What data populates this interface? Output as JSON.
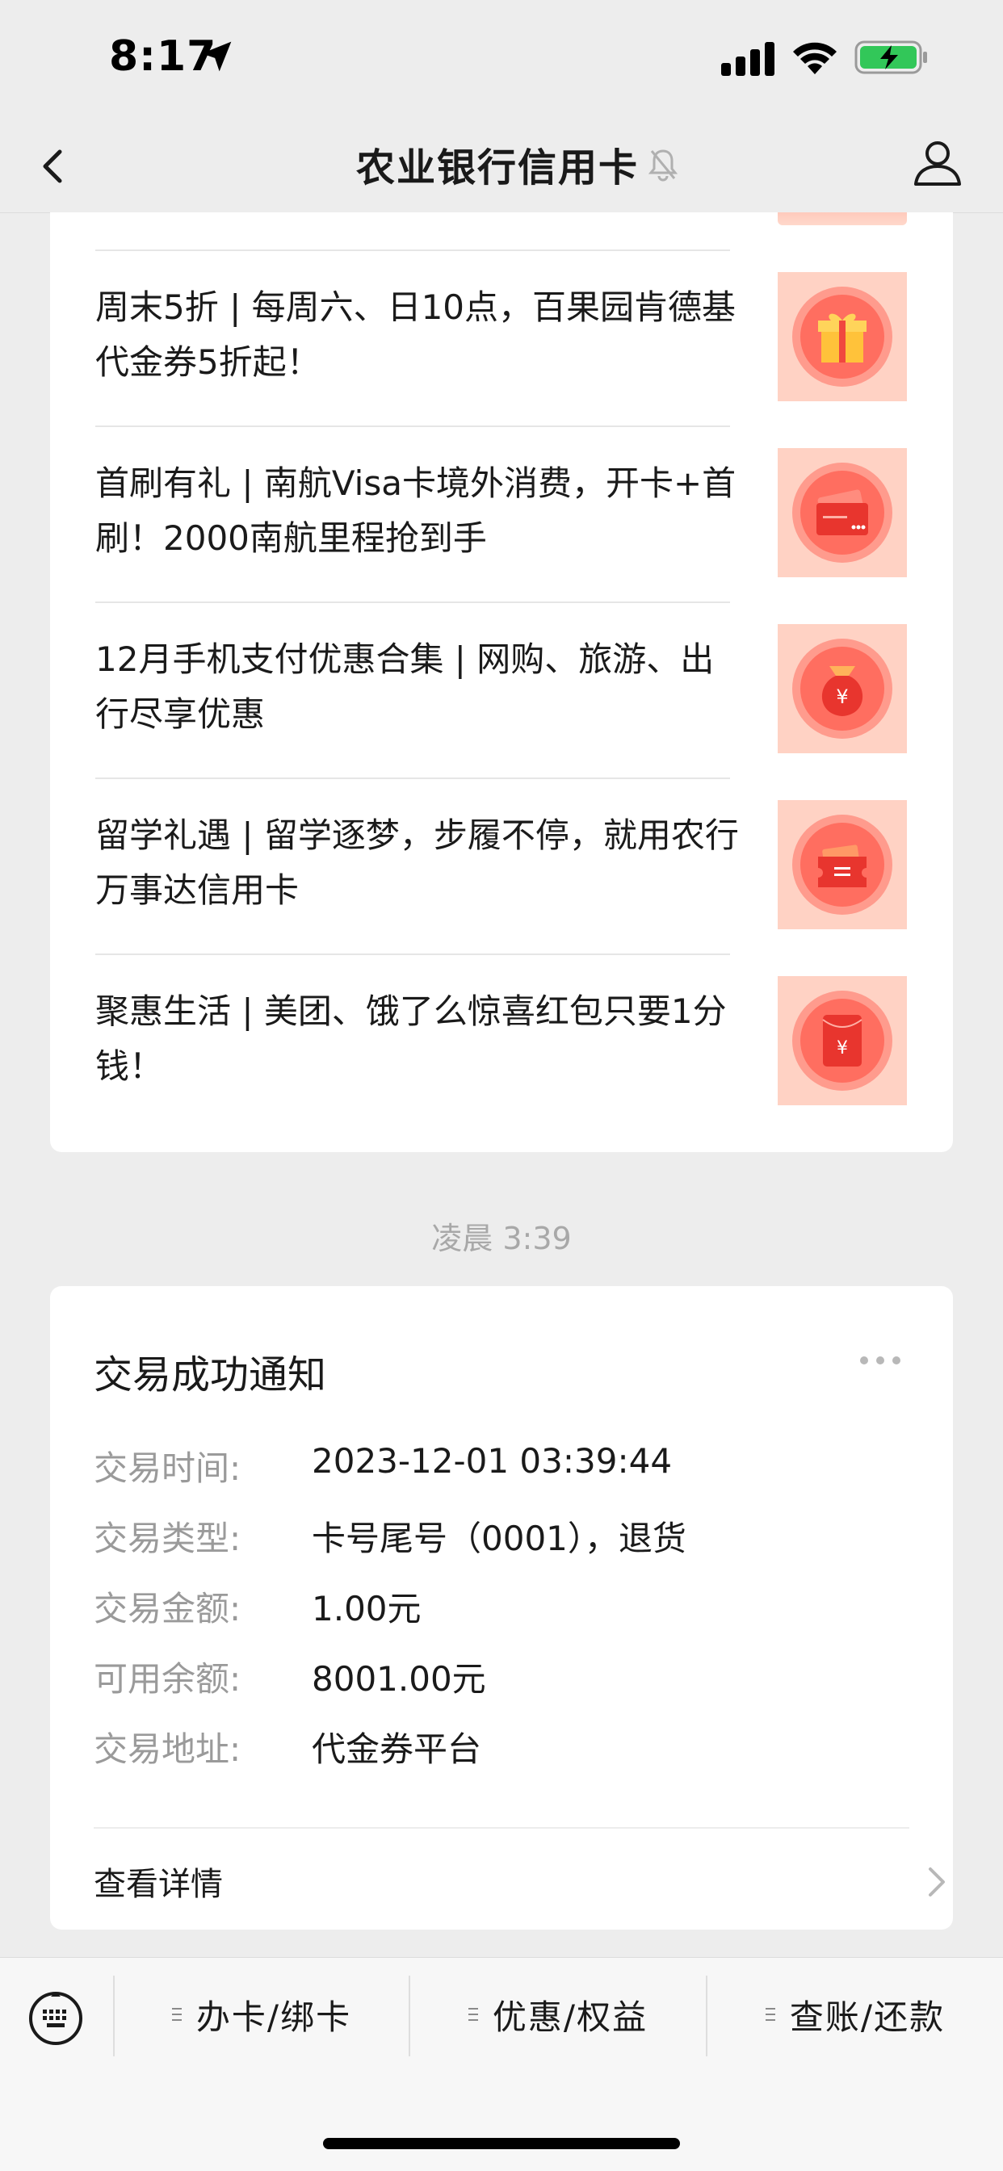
{
  "status_bar": {
    "time": "8:17"
  },
  "nav": {
    "title": "农业银行信用卡"
  },
  "articles": [
    {
      "title": "周末5折 | 每周六、日10点，百果园肯德基代金券5折起！",
      "icon": "gift-icon"
    },
    {
      "title": "首刷有礼 | 南航Visa卡境外消费，开卡+首刷！2000南航里程抢到手",
      "icon": "credit-card-icon"
    },
    {
      "title": "12月手机支付优惠合集 | 网购、旅游、出行尽享优惠",
      "icon": "money-bag-icon"
    },
    {
      "title": "留学礼遇 | 留学逐梦，步履不停，就用农行万事达信用卡",
      "icon": "ticket-icon"
    },
    {
      "title": "聚惠生活 | 美团、饿了么惊喜红包只要1分钱！",
      "icon": "red-envelope-icon"
    }
  ],
  "timestamp": "凌晨 3:39",
  "notice": {
    "title": "交易成功通知",
    "rows": [
      {
        "label": "交易时间:",
        "value": "2023-12-01 03:39:44"
      },
      {
        "label": "交易类型:",
        "value": "卡号尾号（0001），退货"
      },
      {
        "label": "交易金额:",
        "value": "1.00元"
      },
      {
        "label": "可用余额:",
        "value": "8001.00元"
      },
      {
        "label": "交易地址:",
        "value": "代金券平台"
      }
    ],
    "detail_label": "查看详情"
  },
  "menu": {
    "items": [
      {
        "label": "办卡/绑卡"
      },
      {
        "label": "优惠/权益"
      },
      {
        "label": "查账/还款"
      }
    ]
  },
  "colors": {
    "accent_red": "#f0473f",
    "thumb_bg": "#ffd4c7"
  }
}
